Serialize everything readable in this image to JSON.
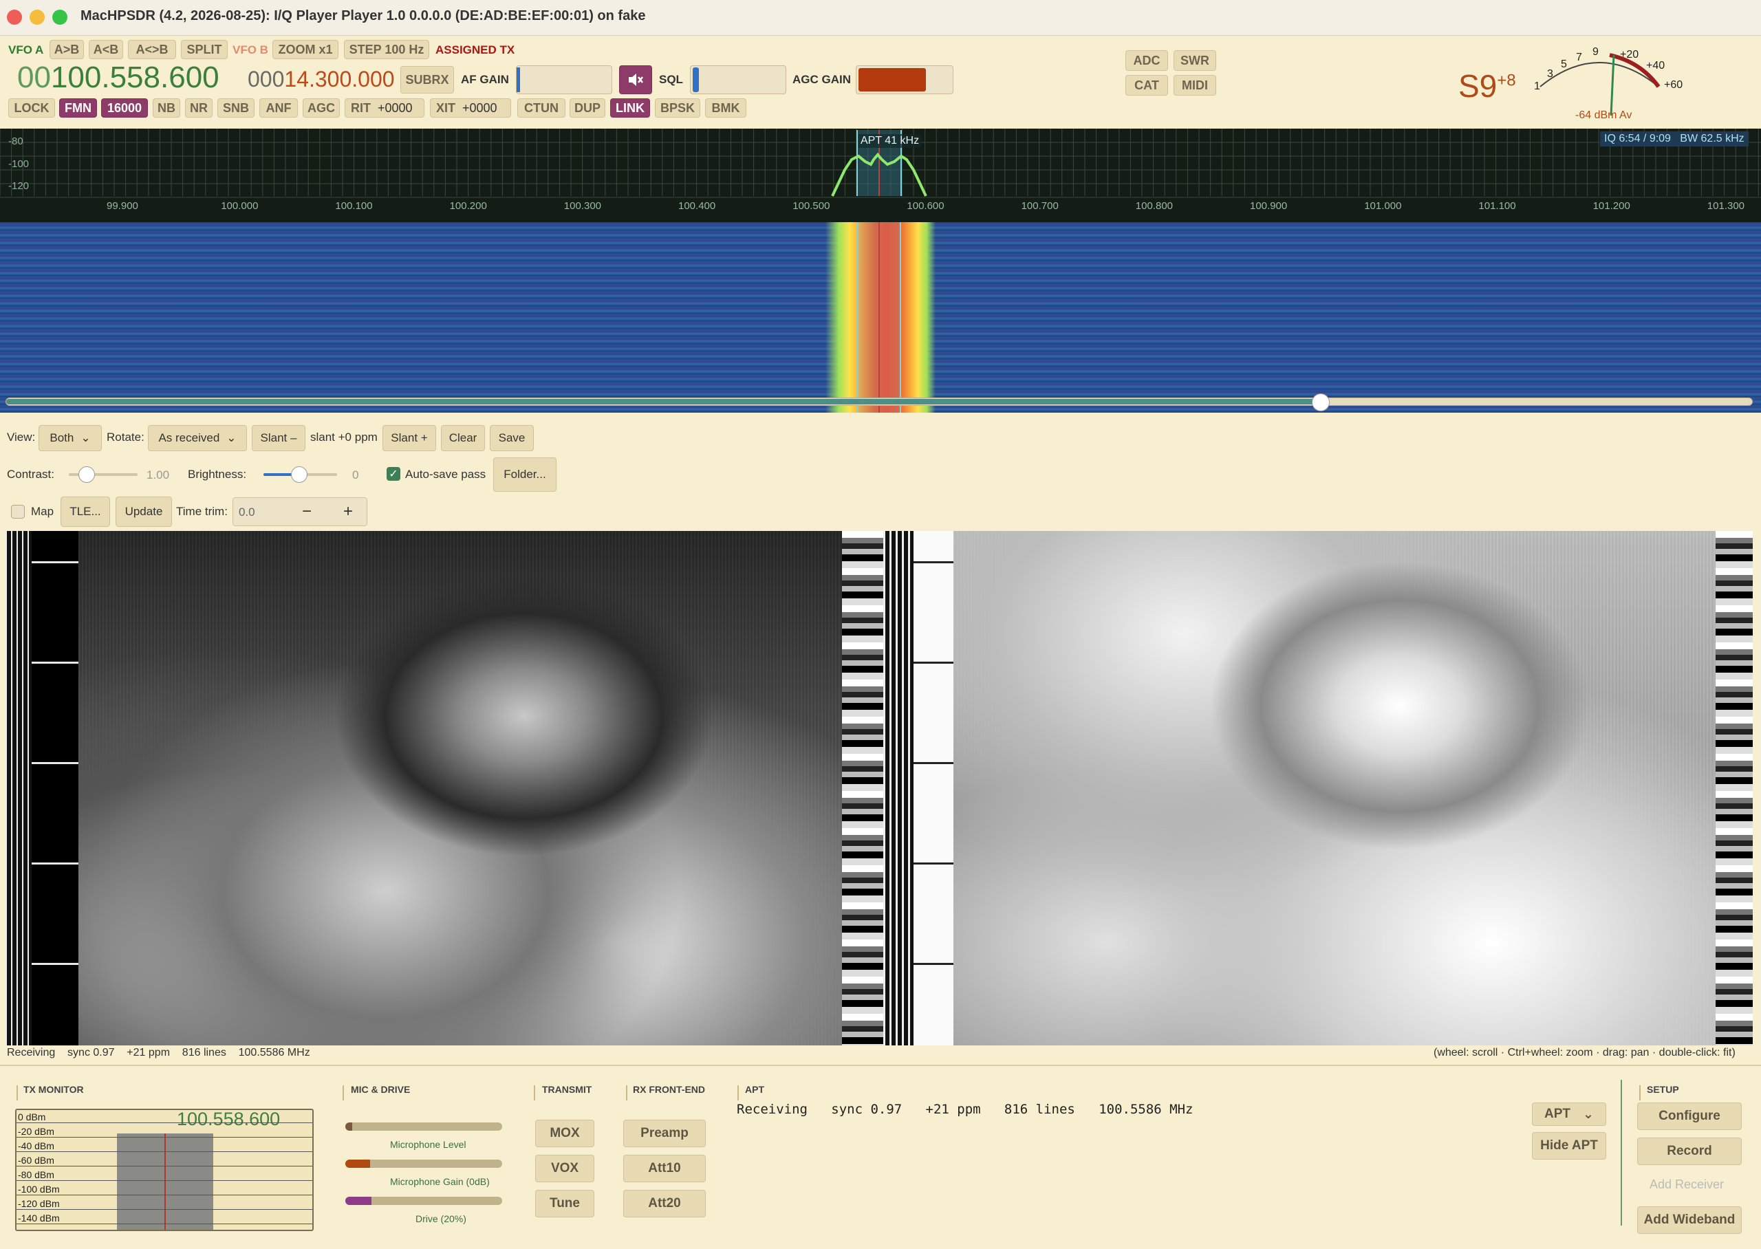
{
  "window": {
    "title": "MacHPSDR (4.2, 2026-08-25): I/Q Player Player 1.0 0.0.0.0 (DE:AD:BE:EF:00:01) on fake"
  },
  "vfo": {
    "a_label": "VFO A",
    "b_label": "VFO B",
    "a_freq_prefix": "00",
    "a_freq": "100.558.600",
    "b_freq_prefix": "000",
    "b_freq": "14.300.000",
    "assigned_tx": "ASSIGNED TX"
  },
  "toolbar": {
    "a_to_b": "A>B",
    "b_to_a": "A<B",
    "swap": "A<>B",
    "split": "SPLIT",
    "zoom": "ZOOM x1",
    "step": "STEP 100 Hz",
    "subrx": "SUBRX",
    "af_gain": "AF GAIN",
    "sql": "SQL",
    "agc_gain": "AGC GAIN",
    "adc": "ADC",
    "swr": "SWR",
    "cat": "CAT",
    "midi": "MIDI",
    "lock": "LOCK",
    "mode": "FMN",
    "filter": "16000",
    "nb": "NB",
    "nr": "NR",
    "snb": "SNB",
    "anf": "ANF",
    "agc": "AGC",
    "rit": "RIT",
    "rit_value": "+0000",
    "xit": "XIT",
    "xit_value": "+0000",
    "ctun": "CTUN",
    "dup": "DUP",
    "link": "LINK",
    "bpsk": "BPSK",
    "bmk": "BMK"
  },
  "meter": {
    "s_reading": "S9",
    "s_plus": "+8",
    "scale": [
      "1",
      "3",
      "5",
      "7",
      "9",
      "+20",
      "+40",
      "+60"
    ],
    "dbm_label": "-64 dBm Av"
  },
  "spectrum": {
    "db_labels": [
      "-80",
      "-100",
      "-120"
    ],
    "freq_labels": [
      "99.900",
      "100.000",
      "100.100",
      "100.200",
      "100.300",
      "100.400",
      "100.500",
      "100.600",
      "100.700",
      "100.800",
      "100.900",
      "101.000",
      "101.100",
      "101.200",
      "101.300"
    ],
    "marker": "APT 41 kHz",
    "iq_info": "IQ 6:54 / 9:09",
    "bw_info": "BW 62.5 kHz",
    "playback_fraction": 0.753
  },
  "apt_controls": {
    "view_label": "View:",
    "view_value": "Both",
    "rotate_label": "Rotate:",
    "rotate_value": "As received",
    "slant_minus": "Slant –",
    "slant_value": "slant +0 ppm",
    "slant_plus": "Slant +",
    "clear": "Clear",
    "save": "Save",
    "contrast_label": "Contrast:",
    "contrast_value": "1.00",
    "brightness_label": "Brightness:",
    "brightness_value": "0",
    "autosave_label": "Auto-save pass",
    "folder": "Folder...",
    "map_label": "Map",
    "tle": "TLE...",
    "update": "Update",
    "trim_label": "Time trim:",
    "trim_value": "0.0",
    "trim_minus": "−",
    "trim_plus": "+"
  },
  "status": {
    "left": "Receiving    sync 0.97    +21 ppm    816 lines    100.5586 MHz",
    "right": "(wheel: scroll · Ctrl+wheel: zoom · drag: pan · double-click: fit)"
  },
  "bottom": {
    "tx_monitor": "TX MONITOR",
    "tx_freq": "100.558.600",
    "tx_dbm_labels": [
      "0 dBm",
      "-20 dBm",
      "-40 dBm",
      "-60 dBm",
      "-80 dBm",
      "-100 dBm",
      "-120 dBm",
      "-140 dBm"
    ],
    "mic_drive": "MIC & DRIVE",
    "mic_level": "Microphone Level",
    "mic_gain": "Microphone Gain (0dB)",
    "drive": "Drive (20%)",
    "transmit": "TRANSMIT",
    "mox": "MOX",
    "vox": "VOX",
    "tune": "Tune",
    "rx_front_end": "RX FRONT-END",
    "preamp": "Preamp",
    "att10": "Att10",
    "att20": "Att20",
    "apt": "APT",
    "apt_status": "Receiving   sync 0.97   +21 ppm   816 lines   100.5586 MHz",
    "apt_select": "APT",
    "hide_apt": "Hide APT",
    "setup": "SETUP",
    "configure": "Configure",
    "record": "Record",
    "add_receiver": "Add Receiver",
    "add_wideband": "Add Wideband"
  }
}
